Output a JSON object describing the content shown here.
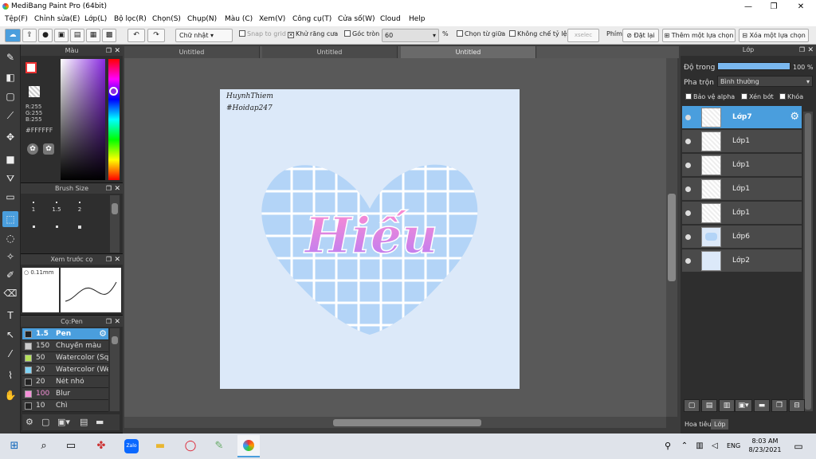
{
  "window": {
    "title": "MediBang Paint Pro (64bit)",
    "min": "—",
    "max": "❐",
    "close": "✕"
  },
  "menu": [
    "Tệp(F)",
    "Chỉnh sửa(E)",
    "Lớp(L)",
    "Bộ lọc(R)",
    "Chọn(S)",
    "Chụp(N)",
    "Màu (C)",
    "Xem(V)",
    "Công cụ(T)",
    "Cửa số(W)",
    "Cloud",
    "Help"
  ],
  "toolbar": {
    "shape": "Chữ nhật",
    "snap": "Snap to grid",
    "antialias": "Khử răng cưa",
    "round": "Góc tròn",
    "round_val": "60",
    "percent": "%",
    "center": "Chọn từ giữa",
    "noratio": "Không chế tỷ lệ",
    "deselect": "xselec",
    "keys": "Phím",
    "reset": "Đặt lại",
    "add_sel": "Thêm một lựa chọn",
    "del_sel": "Xóa một lựa chọn"
  },
  "color_panel": {
    "title": "Màu",
    "r": "R:255",
    "g": "G:255",
    "b": "B:255",
    "hex": "#FFFFFF"
  },
  "brush_size": {
    "title": "Brush Size",
    "sizes": [
      "1",
      "1.5",
      "2"
    ]
  },
  "preview": {
    "title": "Xem trước cọ",
    "size": "0.11mm"
  },
  "pen_panel": {
    "title": "Cọ:Pen",
    "items": [
      {
        "size": "1.5",
        "name": "Pen",
        "color": "#222222",
        "selected": true
      },
      {
        "size": "150",
        "name": "Chuyển màu",
        "color": "#cccccc"
      },
      {
        "size": "50",
        "name": "Watercolor (Squ",
        "color": "#b6e25a"
      },
      {
        "size": "20",
        "name": "Watercolor (Wet",
        "color": "#7fd3f5"
      },
      {
        "size": "20",
        "name": "Nét nhỏ",
        "color": "#222222"
      },
      {
        "size": "100",
        "name": "Blur",
        "color": "#f58fd8"
      },
      {
        "size": "10",
        "name": "Chì",
        "color": "#222222"
      }
    ]
  },
  "tabs": [
    "Untitled",
    "Untitled",
    "Untitled"
  ],
  "canvas": {
    "line1": "HuynhThiem",
    "line2": "#Hoidap247",
    "word": "Hiếu"
  },
  "layer_panel": {
    "title": "Lớp",
    "opacity_label": "Độ trong",
    "opacity": "100 %",
    "blend_label": "Pha trộn",
    "blend": "Bình thường",
    "protect": "Bảo vệ alpha",
    "clip": "Xén bớt",
    "lock": "Khóa",
    "layers": [
      "Lớp7",
      "Lớp1",
      "Lớp1",
      "Lớp1",
      "Lớp1",
      "Lớp6",
      "Lớp2"
    ],
    "bottom_tabs": [
      "Hoa tiêu",
      "Lớp"
    ]
  },
  "taskbar": {
    "lang": "ENG",
    "time": "8:03 AM",
    "date": "8/23/2021",
    "zalo": "Zalo"
  },
  "colors": {
    "accent": "#4a9edd",
    "canvas_bg": "#dce9f9",
    "heart": "#b3d4f7"
  }
}
